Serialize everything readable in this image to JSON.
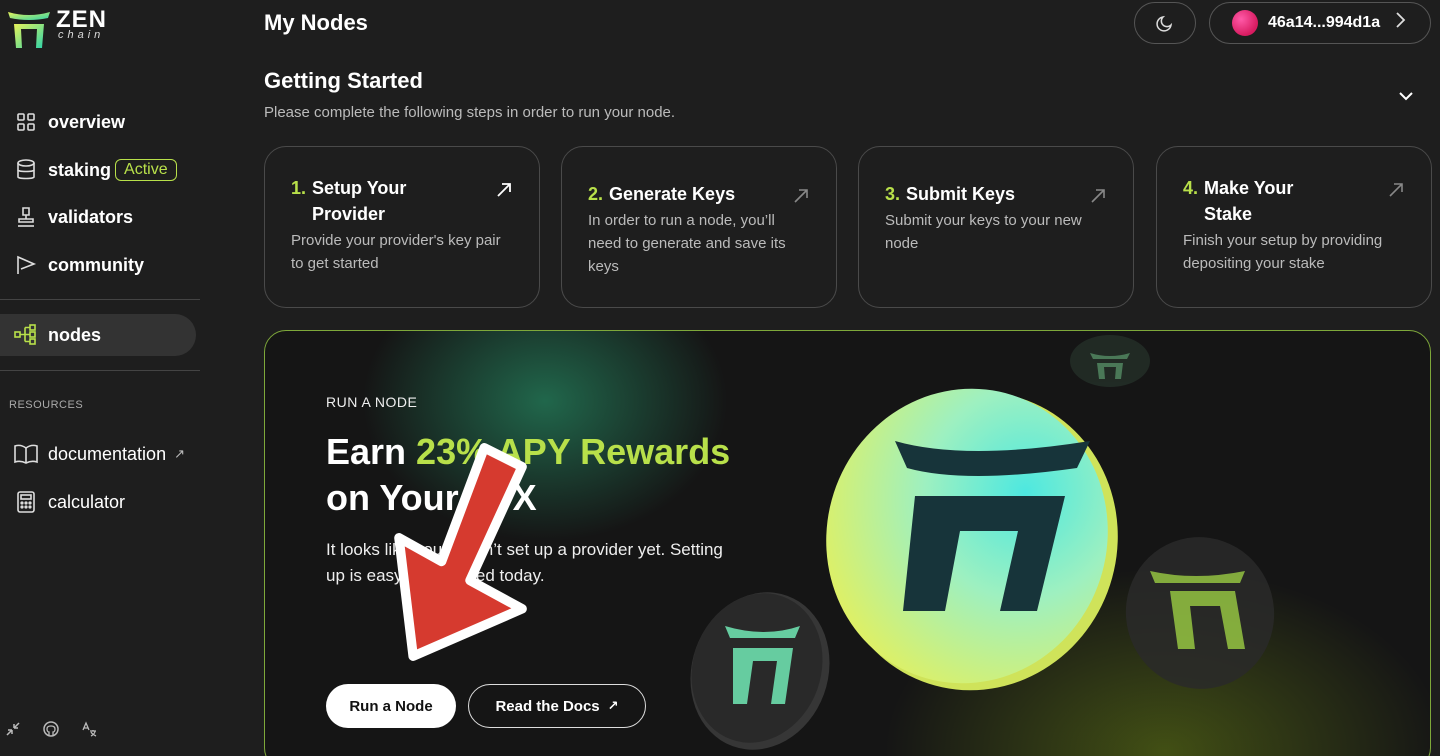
{
  "brand": {
    "name": "ZEN",
    "sub": "chain",
    "color": "#b8e04a"
  },
  "sidebar": {
    "items": [
      {
        "label": "overview",
        "icon": "grid-icon"
      },
      {
        "label": "staking",
        "icon": "database-icon",
        "badge": "Active"
      },
      {
        "label": "validators",
        "icon": "stamp-icon"
      },
      {
        "label": "community",
        "icon": "flag-icon"
      },
      {
        "label": "nodes",
        "icon": "nodes-icon",
        "active": true
      }
    ],
    "resources_label": "RESOURCES",
    "resources": [
      {
        "label": "documentation",
        "icon": "book-icon",
        "external": "↗"
      },
      {
        "label": "calculator",
        "icon": "calculator-icon"
      }
    ],
    "footer_icons": [
      "collapse-icon",
      "github-icon",
      "translate-icon"
    ]
  },
  "header": {
    "title": "My Nodes",
    "wallet": {
      "address": "46a14...994d1a"
    }
  },
  "getting_started": {
    "title": "Getting Started",
    "subtitle": "Please complete the following steps in order to run your node.",
    "steps": [
      {
        "num": "1.",
        "title": "Setup Your Provider",
        "desc": "Provide your provider's key pair to get started"
      },
      {
        "num": "2.",
        "title": "Generate Keys",
        "desc": "In order to run a node, you’ll need to generate and save its keys"
      },
      {
        "num": "3.",
        "title": "Submit Keys",
        "desc": "Submit your keys to your new node"
      },
      {
        "num": "4.",
        "title": "Make Your Stake",
        "desc": "Finish your setup by providing depositing your stake"
      }
    ]
  },
  "hero": {
    "kicker": "RUN A NODE",
    "title_prefix": "Earn ",
    "title_accent": "23% APY Rewards",
    "title_suffix": "on Your ZTX",
    "text": "It looks like you haven’t set up a provider yet. Setting up is easy. Get started today.",
    "primary_button": "Run a Node",
    "secondary_button": "Read the Docs",
    "secondary_ext": "↗"
  },
  "colors": {
    "accent": "#b8e04a",
    "annotation_arrow": "#d63a2f"
  }
}
